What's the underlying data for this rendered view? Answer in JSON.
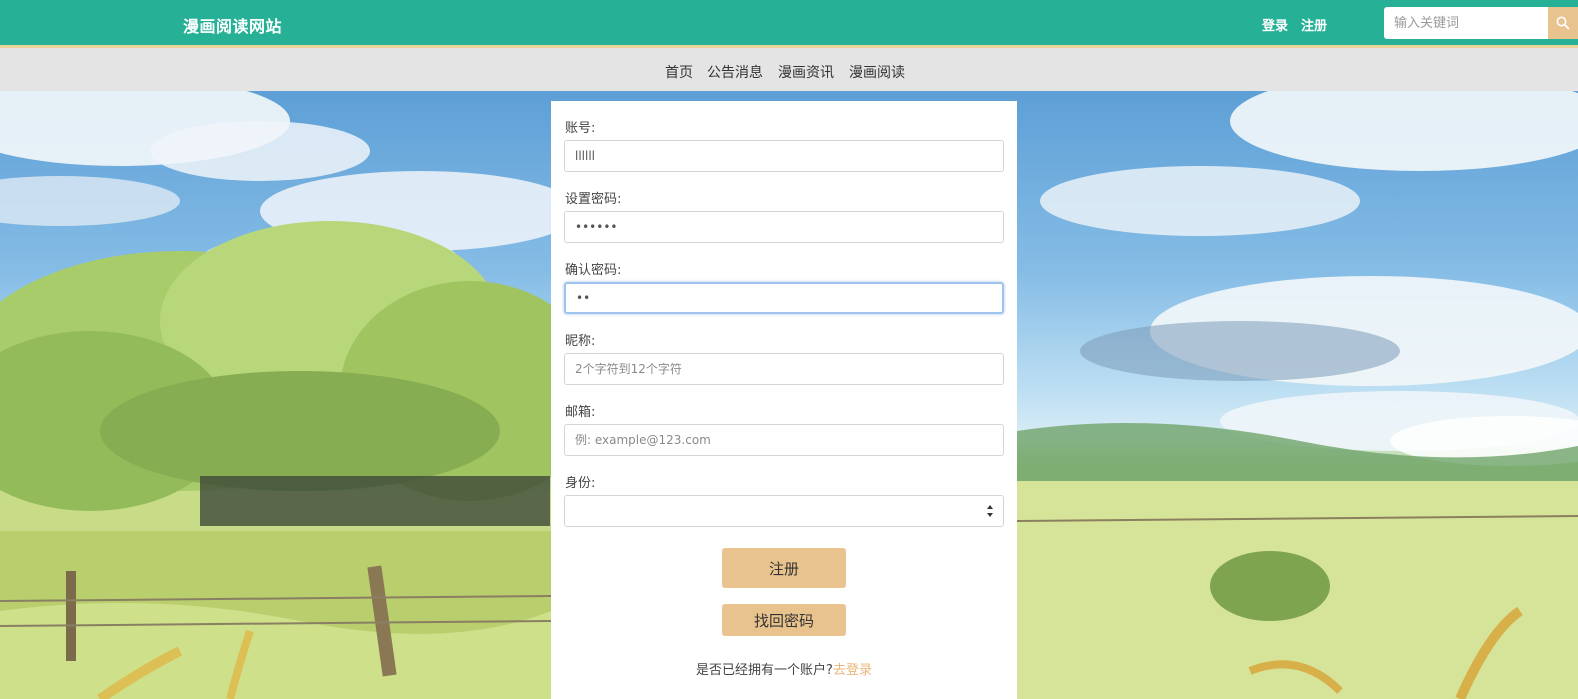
{
  "header": {
    "brand": "漫画阅读网站",
    "login_label": "登录",
    "register_label": "注册",
    "search_placeholder": "输入关键词",
    "search_icon": "search-icon"
  },
  "nav": {
    "items": [
      "首页",
      "公告消息",
      "漫画资讯",
      "漫画阅读"
    ]
  },
  "form": {
    "account_label": "账号:",
    "account_value": "llllll",
    "password_label": "设置密码:",
    "password_value": "••••••",
    "confirm_label": "确认密码:",
    "confirm_value": "••",
    "nickname_label": "昵称:",
    "nickname_placeholder": "2个字符到12个字符",
    "email_label": "邮箱:",
    "email_placeholder": "例: example@123.com",
    "identity_label": "身份:",
    "identity_selected": "",
    "register_button": "注册",
    "recover_button": "找回密码",
    "footer_prompt": "是否已经拥有一个账户?",
    "footer_link": "去登录"
  },
  "colors": {
    "topbar": "#26b197",
    "accent": "#e9c38e",
    "navbar": "#e4e4e4",
    "link": "#e9b57a"
  }
}
